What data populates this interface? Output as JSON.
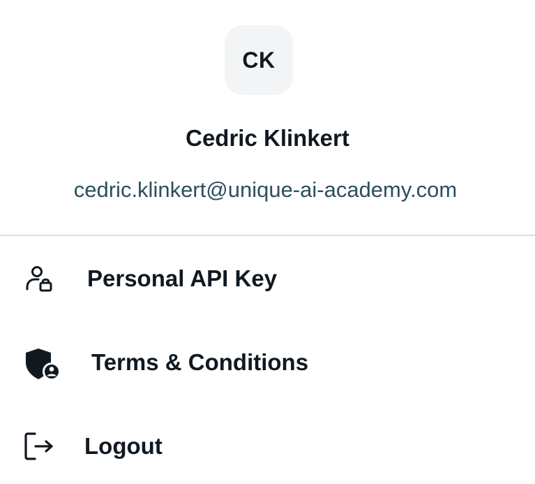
{
  "profile": {
    "initials": "CK",
    "name": "Cedric Klinkert",
    "email": "cedric.klinkert@unique-ai-academy.com"
  },
  "menu": {
    "items": [
      {
        "label": "Personal API Key",
        "icon": "user-lock-icon"
      },
      {
        "label": "Terms & Conditions",
        "icon": "shield-user-icon"
      },
      {
        "label": "Logout",
        "icon": "logout-icon"
      }
    ]
  },
  "colors": {
    "text": "#101820",
    "email": "#2c4f5e",
    "avatar_bg": "#f3f4f5",
    "divider": "#dcdfe1"
  }
}
